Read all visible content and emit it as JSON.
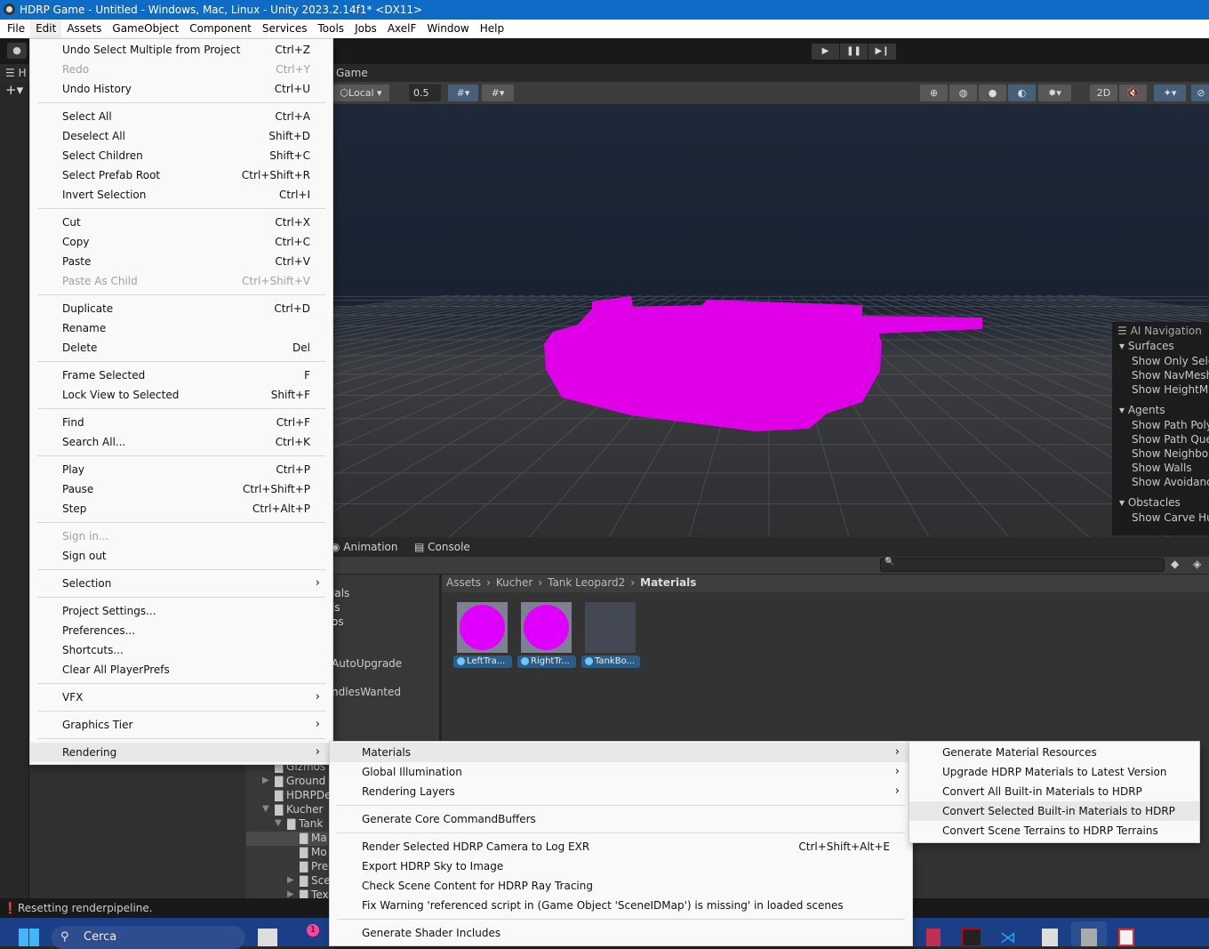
{
  "window": {
    "title": "HDRP Game - Untitled - Windows, Mac, Linux - Unity 2023.2.14f1* <DX11>"
  },
  "menubar": [
    "File",
    "Edit",
    "Assets",
    "GameObject",
    "Component",
    "Services",
    "Tools",
    "Jobs",
    "AxelF",
    "Window",
    "Help"
  ],
  "hierarchy": {
    "title": "H"
  },
  "game": {
    "tab": "Game",
    "pivot": "Local",
    "snap_value": "0.5",
    "btn_2d": "2D"
  },
  "nav_overlay": {
    "title": "AI Navigation",
    "items": [
      {
        "text": "Surfaces",
        "header": true
      },
      {
        "text": "Show Only Selected"
      },
      {
        "text": "Show NavMesh"
      },
      {
        "text": "Show HeightMesh"
      },
      {
        "text": "Agents",
        "header": true
      },
      {
        "text": "Show Path Polygons"
      },
      {
        "text": "Show Path Query Nodes"
      },
      {
        "text": "Show Neighbours"
      },
      {
        "text": "Show Walls"
      },
      {
        "text": "Show Avoidance"
      },
      {
        "text": "Obstacles",
        "header": true
      },
      {
        "text": "Show Carve Hull"
      }
    ]
  },
  "bottom_tabs": {
    "animation": "Animation",
    "console": "Console"
  },
  "breadcrumb": [
    "Assets",
    "Kucher",
    "Tank Leopard2",
    "Materials"
  ],
  "assets": [
    {
      "name": "LeftTra...",
      "preview": "#e000ff"
    },
    {
      "name": "RightTr...",
      "preview": "#e000ff"
    },
    {
      "name": "TankBo...",
      "preview": "#434854"
    }
  ],
  "project_tree_partial": [
    "ials",
    "ls",
    "os",
    "AutoUpgrade",
    "ndlesWanted"
  ],
  "folders": [
    {
      "name": "Gizmos",
      "expanded": false
    },
    {
      "name": "Ground",
      "arrow": true
    },
    {
      "name": "HDRPDe"
    },
    {
      "name": "Kucher",
      "open": true
    },
    {
      "name": "Tank",
      "open": true
    },
    {
      "name": "Ma",
      "selected": true
    },
    {
      "name": "Mo"
    },
    {
      "name": "Pre"
    },
    {
      "name": "Sce",
      "arrow": true
    },
    {
      "name": "Tex",
      "arrow": true
    }
  ],
  "status": "Resetting renderpipeline.",
  "taskbar": {
    "search": "Cerca",
    "badge": "1"
  },
  "edit_menu": [
    [
      {
        "t": "Undo Select Multiple from Project",
        "s": "Ctrl+Z"
      },
      {
        "t": "Redo",
        "s": "Ctrl+Y",
        "dis": true
      },
      {
        "t": "Undo History",
        "s": "Ctrl+U"
      }
    ],
    [
      {
        "t": "Select All",
        "s": "Ctrl+A"
      },
      {
        "t": "Deselect All",
        "s": "Shift+D"
      },
      {
        "t": "Select Children",
        "s": "Shift+C"
      },
      {
        "t": "Select Prefab Root",
        "s": "Ctrl+Shift+R"
      },
      {
        "t": "Invert Selection",
        "s": "Ctrl+I"
      }
    ],
    [
      {
        "t": "Cut",
        "s": "Ctrl+X"
      },
      {
        "t": "Copy",
        "s": "Ctrl+C"
      },
      {
        "t": "Paste",
        "s": "Ctrl+V"
      },
      {
        "t": "Paste As Child",
        "s": "Ctrl+Shift+V",
        "dis": true
      }
    ],
    [
      {
        "t": "Duplicate",
        "s": "Ctrl+D"
      },
      {
        "t": "Rename",
        "s": ""
      },
      {
        "t": "Delete",
        "s": "Del"
      }
    ],
    [
      {
        "t": "Frame Selected",
        "s": "F"
      },
      {
        "t": "Lock View to Selected",
        "s": "Shift+F"
      }
    ],
    [
      {
        "t": "Find",
        "s": "Ctrl+F"
      },
      {
        "t": "Search All...",
        "s": "Ctrl+K"
      }
    ],
    [
      {
        "t": "Play",
        "s": "Ctrl+P"
      },
      {
        "t": "Pause",
        "s": "Ctrl+Shift+P"
      },
      {
        "t": "Step",
        "s": "Ctrl+Alt+P"
      }
    ],
    [
      {
        "t": "Sign in...",
        "s": "",
        "dis": true
      },
      {
        "t": "Sign out",
        "s": ""
      }
    ],
    [
      {
        "t": "Selection",
        "sub": true
      }
    ],
    [
      {
        "t": "Project Settings..."
      },
      {
        "t": "Preferences..."
      },
      {
        "t": "Shortcuts..."
      },
      {
        "t": "Clear All PlayerPrefs"
      }
    ],
    [
      {
        "t": "VFX",
        "sub": true
      }
    ],
    [
      {
        "t": "Graphics Tier",
        "sub": true
      }
    ],
    [
      {
        "t": "Rendering",
        "sub": true,
        "hl": true
      }
    ]
  ],
  "rendering_menu": [
    [
      {
        "t": "Materials",
        "sub": true,
        "hl": true
      },
      {
        "t": "Global Illumination",
        "sub": true
      },
      {
        "t": "Rendering Layers",
        "sub": true
      }
    ],
    [
      {
        "t": "Generate Core CommandBuffers"
      }
    ],
    [
      {
        "t": "Render Selected HDRP Camera to Log EXR",
        "s": "Ctrl+Shift+Alt+E"
      },
      {
        "t": "Export HDRP Sky to Image"
      },
      {
        "t": "Check Scene Content for HDRP Ray Tracing"
      },
      {
        "t": "Fix Warning 'referenced script in (Game Object 'SceneIDMap') is missing' in loaded scenes"
      }
    ],
    [
      {
        "t": "Generate Shader Includes"
      }
    ]
  ],
  "materials_menu": [
    [
      {
        "t": "Generate Material Resources"
      },
      {
        "t": "Upgrade HDRP Materials to Latest Version"
      },
      {
        "t": "Convert All Built-in Materials to HDRP"
      },
      {
        "t": "Convert Selected Built-in Materials to HDRP",
        "hl": true
      },
      {
        "t": "Convert Scene Terrains to HDRP Terrains"
      }
    ]
  ]
}
